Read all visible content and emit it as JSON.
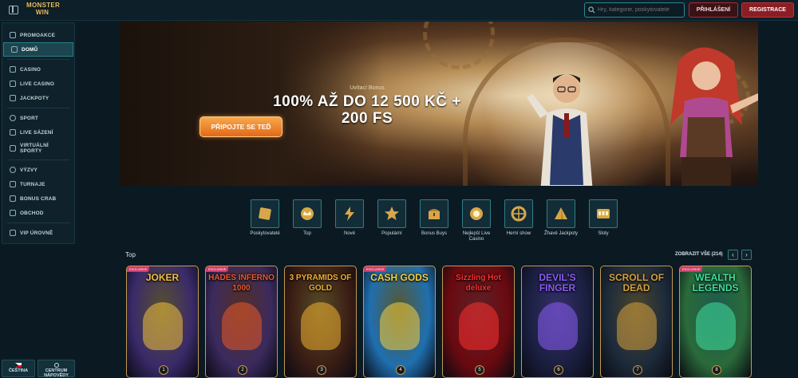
{
  "header": {
    "logo_line1": "MONSTER",
    "logo_line2": "WIN",
    "search_placeholder": "Hry, kategorie, poskytovatelé",
    "login_label": "PŘIHLÁŠENÍ",
    "register_label": "REGISTRACE"
  },
  "sidebar": {
    "items": [
      {
        "label": "PROMOAKCE",
        "icon": "gift-icon"
      },
      {
        "label": "DOMŮ",
        "icon": "home-icon",
        "active": true
      },
      {
        "label": "CASINO",
        "icon": "cards-icon"
      },
      {
        "label": "LIVE CASINO",
        "icon": "live-icon"
      },
      {
        "label": "JACKPOTY",
        "icon": "jackpot-icon"
      },
      {
        "label": "SPORT",
        "icon": "ball-icon"
      },
      {
        "label": "LIVE SÁZENÍ",
        "icon": "live-bet-icon"
      },
      {
        "label": "VIRTUÁLNÍ SPORTY",
        "icon": "virtual-icon"
      },
      {
        "label": "VÝZVY",
        "icon": "target-icon"
      },
      {
        "label": "TURNAJE",
        "icon": "trophy-icon"
      },
      {
        "label": "BONUS CRAB",
        "icon": "crab-icon"
      },
      {
        "label": "OBCHOD",
        "icon": "shop-icon"
      },
      {
        "label": "VIP ÚROVNĚ",
        "icon": "crown-icon"
      }
    ],
    "language_label": "ČEŠTINA",
    "help_label_1": "CENTRUM",
    "help_label_2": "NÁPOVĚDY"
  },
  "banner": {
    "subtitle": "Uvítací Bonus",
    "title_line1": "100% AŽ DO 12 500 KČ +",
    "title_line2": "200 FS",
    "cta_label": "PŘIPOJTE SE TEĎ"
  },
  "categories": [
    {
      "label": "Poskytovatelé",
      "icon": "provider-icon"
    },
    {
      "label": "Top",
      "icon": "crown-icon"
    },
    {
      "label": "Nové",
      "icon": "lightning-icon"
    },
    {
      "label": "Populární",
      "icon": "star-icon"
    },
    {
      "label": "Bonus Buys",
      "icon": "chest-icon"
    },
    {
      "label": "Nejlepší Live Casino",
      "icon": "chip-icon"
    },
    {
      "label": "Herní show",
      "icon": "wheel-icon"
    },
    {
      "label": "Žhavé Jackpoty",
      "icon": "pyramid-icon"
    },
    {
      "label": "Sloty",
      "icon": "slot-icon"
    }
  ],
  "top_section": {
    "title": "Top",
    "show_all": "ZOBRAZIT VŠE (214)",
    "games": [
      {
        "name": "JOKER",
        "rank": "1",
        "tag": "EXCLUSIVE",
        "bg": "#3a2a6a",
        "accent": "#f0c040"
      },
      {
        "name": "HADES INFERNO 1000",
        "rank": "2",
        "tag": "EXCLUSIVE",
        "bg": "#3b2a5e",
        "accent": "#e85a2a"
      },
      {
        "name": "3 PYRAMIDS OF GOLD",
        "rank": "3",
        "tag": "",
        "bg": "#3a1d14",
        "accent": "#f0b030"
      },
      {
        "name": "CASH GODS",
        "rank": "4",
        "tag": "EXCLUSIVE",
        "bg": "#1f6fb0",
        "accent": "#f5d040"
      },
      {
        "name": "Sizzling Hot deluxe",
        "rank": "5",
        "tag": "",
        "bg": "#6a0a10",
        "accent": "#ff3030"
      },
      {
        "name": "DEVIL'S FINGER",
        "rank": "6",
        "tag": "",
        "bg": "#1a1f40",
        "accent": "#8b5cf6"
      },
      {
        "name": "SCROLL OF DEAD",
        "rank": "7",
        "tag": "",
        "bg": "#1c2a3a",
        "accent": "#d4a040"
      },
      {
        "name": "WEALTH LEGENDS",
        "rank": "8",
        "tag": "EXCLUSIVE",
        "bg": "#2a6a3a",
        "accent": "#40e0a0"
      }
    ]
  }
}
